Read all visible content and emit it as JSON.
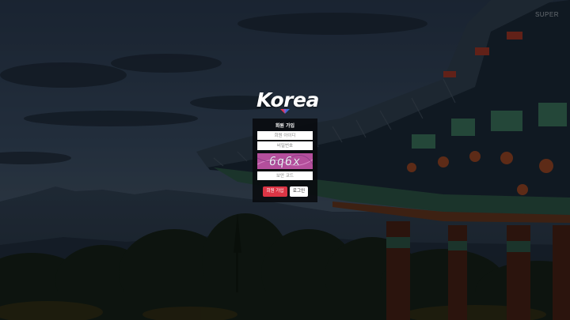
{
  "corner_text": "SUPER",
  "logo": {
    "text": "Korea"
  },
  "login": {
    "title": "회원 가입",
    "id_placeholder": "회원 아이디",
    "password_placeholder": "비밀번호",
    "captcha_text": "6q6x",
    "code_placeholder": "보안 코드",
    "join_label": "회원 가입",
    "login_label": "로그인"
  },
  "colors": {
    "join_button": "#dc3545",
    "captcha_bg": "#b44f9c",
    "panel_bg": "#080a0e"
  }
}
